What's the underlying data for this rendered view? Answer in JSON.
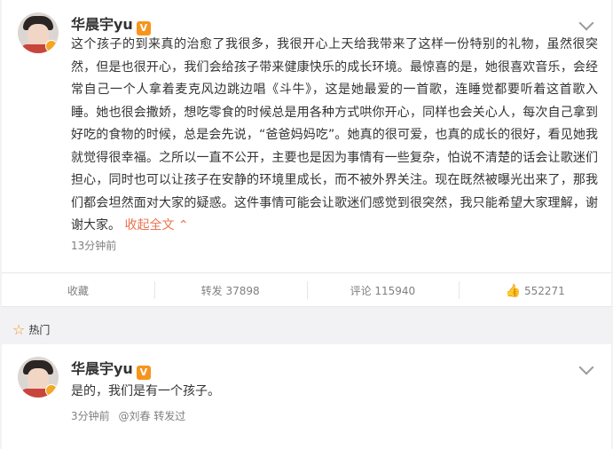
{
  "post1": {
    "author": "华晨宇yu",
    "vip_badge": "V",
    "text": "这个孩子的到来真的治愈了我很多，我很开心上天给我带来了这样一份特别的礼物，虽然很突然，但是也很开心，我们会给孩子带来健康快乐的成长环境。最惊喜的是，她很喜欢音乐，会经常自己一个人拿着麦克风边跳边唱《斗牛》，这是她最爱的一首歌，连睡觉都要听着这首歌入睡。她也很会撒娇，想吃零食的时候总是用各种方式哄你开心，同样也会关心人，每次自己拿到好吃的食物的时候，总是会先说，“爸爸妈妈吃”。她真的很可爱，也真的成长的很好，看见她我就觉得很幸福。之所以一直不公开，主要也是因为事情有一些复杂，怕说不清楚的话会让歌迷们担心，同时也可以让孩子在安静的环境里成长，而不被外界关注。现在既然被曝光出来了，那我们都会坦然面对大家的疑惑。这件事情可能会让歌迷们感觉到很突然，我只能希望大家理解，谢谢大家。",
    "collapse_label": "收起全文",
    "time": "13分钟前",
    "actions": {
      "favorite": "收藏",
      "repost": "转发 37898",
      "comment": "评论 115940",
      "like": "552271"
    }
  },
  "hot_section": {
    "label": "热门"
  },
  "post2": {
    "author": "华晨宇yu",
    "vip_badge": "V",
    "text": "是的，我们是有一个孩子。",
    "time": "3分钟前",
    "reposted_by": "@刘春 转发过"
  },
  "icons": {
    "chevron": "chevron-down-icon",
    "like": "thumbs-up-icon",
    "star": "star-icon",
    "collapse": "chevron-up-icon"
  }
}
